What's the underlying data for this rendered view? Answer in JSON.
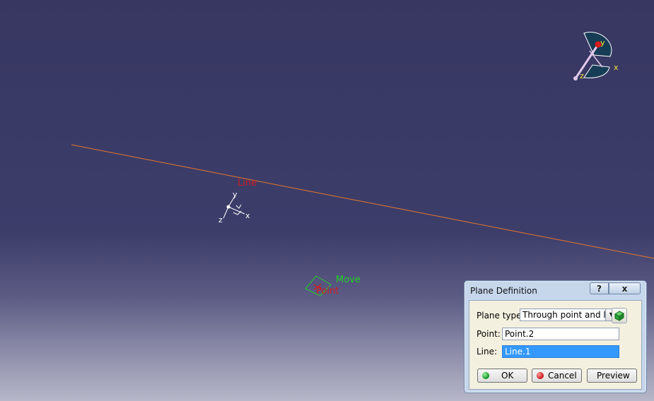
{
  "viewport": {
    "line_label": "Line",
    "point_move_label": "Move",
    "point_label": "Point",
    "axis_labels": {
      "x": "x",
      "y": "y",
      "z": "z"
    },
    "compass_labels": {
      "x": "x",
      "y": "y",
      "z": "z"
    }
  },
  "dialog": {
    "title": "Plane Definition",
    "help": "?",
    "close": "x",
    "plane_type_label": "Plane type:",
    "plane_type_value": "Through point and lin",
    "point_label": "Point:",
    "point_value": "Point.2",
    "line_label": "Line:",
    "line_value": "Line.1",
    "ok": "OK",
    "cancel": "Cancel",
    "preview": "Preview"
  },
  "colors": {
    "line": "#e7782a",
    "selection_red": "#cf1f1f",
    "move_green": "#25d025",
    "field_selected": "#3399ff",
    "ok_dot": "#1aa12b",
    "cancel_dot": "#d12424"
  }
}
